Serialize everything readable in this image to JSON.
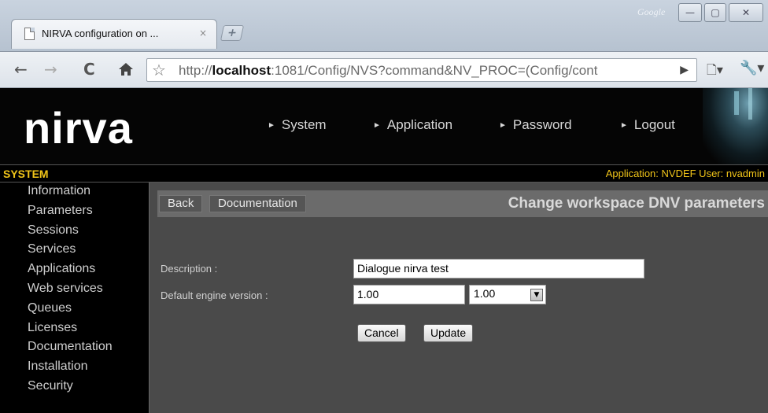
{
  "browser": {
    "tab_title": "NIRVA configuration on ...",
    "tab_close": "×",
    "new_tab": "+",
    "google_label": "Google",
    "window_buttons": {
      "minimize": "—",
      "maximize": "▢",
      "close": "✕"
    },
    "url_prefix": "http://",
    "url_host": "localhost",
    "url_rest": ":1081/Config/NVS?command&NV_PROC=(Config/cont"
  },
  "icons": {
    "back": "back-arrow-icon",
    "forward": "forward-arrow-icon",
    "reload": "reload-icon",
    "home": "home-icon",
    "bookmark": "star-icon",
    "go": "play-arrow-icon",
    "page_menu": "page-menu-icon",
    "wrench_menu": "wrench-icon"
  },
  "header": {
    "logo": "nirva",
    "nav": [
      "System",
      "Application",
      "Password",
      "Logout"
    ]
  },
  "sysbar": {
    "title": "SYSTEM",
    "info": "Application: NVDEF  User: nvadmin"
  },
  "sidebar": {
    "items": [
      "Information",
      "Parameters",
      "Sessions",
      "Services",
      "Applications",
      "Web services",
      "Queues",
      "Licenses",
      "Documentation",
      "Installation",
      "Security"
    ]
  },
  "actions": {
    "back": "Back",
    "documentation": "Documentation",
    "heading": "Change workspace DNV parameters"
  },
  "form": {
    "description_label": "Description :",
    "description_value": "Dialogue nirva test",
    "engine_label": "Default engine version :",
    "engine_value": "1.00",
    "engine_select": "1.00",
    "cancel": "Cancel",
    "update": "Update"
  },
  "colors": {
    "accent": "#f0c419",
    "header_bg": "#050505",
    "content_bg": "#4a4a4a"
  }
}
